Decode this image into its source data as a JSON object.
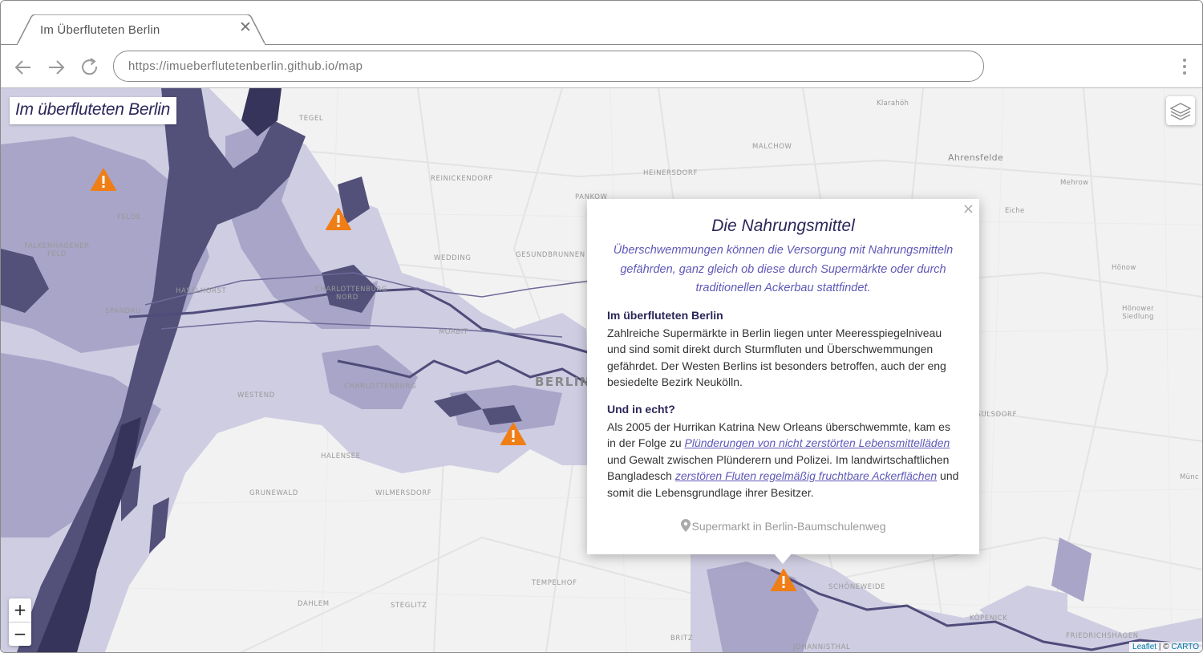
{
  "browser": {
    "tab_title": "Im Überfluteten Berlin",
    "url": "https://imueberflutetenberlin.github.io/map"
  },
  "map": {
    "title": "Im überfluteten Berlin",
    "zoom_in": "+",
    "zoom_out": "−",
    "attribution_leaflet": "Leaflet",
    "attribution_sep": " | © ",
    "attribution_carto": "CARTO",
    "flood_colors": {
      "light": "#cfcde2",
      "medium": "#a8a5c8",
      "dark": "#53507a",
      "darkest": "#36345a"
    },
    "marker_color": "#f07e16",
    "labels": {
      "klarahoh": "Klarahöh",
      "tegel": "TEGEL",
      "malchow": "MALCHOW",
      "ahrensfelde": "Ahrensfelde",
      "reinickendorf": "REINICKENDORF",
      "heinersdorf": "HEINERSDORF",
      "mehrow": "Mehrow",
      "pankow": "PANKOW",
      "eiche": "Eiche",
      "falkenhagener_feld": "FALKENHAGENER FELD",
      "wedding": "WEDDING",
      "gesundbrunnen": "GESUNDBRUNNEN",
      "honow": "Hönow",
      "haselhorst": "HASELHORST",
      "charlottenburg_nord": "CHARLOTTENBURG NORD",
      "spandau": "SPANDAU",
      "honower_siedlung": "Hönower Siedlung",
      "moabit": "MOABIT",
      "berlin": "BERLIN",
      "westend": "WESTEND",
      "charlottenburg": "CHARLOTTENBURG",
      "kaulsdorf": "KAULSDORF",
      "halensee": "HALENSEE",
      "munch": "Münc",
      "wilmersdorf": "WILMERSDORF",
      "grunewald": "GRUNEWALD",
      "tempelhof": "TEMPELHOF",
      "schoneweide": "SCHÖNEWEIDE",
      "dahlem": "DAHLEM",
      "steglitz": "STEGLITZ",
      "kopenick": "KÖPENICK",
      "britz": "BRITZ",
      "friedrichshagen": "FRIEDRICHSHAGEN",
      "johannisthal": "JOHANNISTHAL",
      "felde": "FELDE"
    }
  },
  "popup": {
    "close": "×",
    "heading": "Die Nahrungsmittel",
    "intro": "Überschwemmungen können die Versorgung mit Nahrungsmitteln gefährden, ganz gleich ob diese durch Supermärkte oder durch traditionellen Ackerbau stattfindet.",
    "section1_title": "Im überfluteten Berlin",
    "section1_text": "Zahlreiche Supermärkte in Berlin liegen unter Meeresspiegelniveau und sind somit direkt durch Sturmfluten und Überschwemmungen gefährdet. Der Westen Berlins ist besonders betroffen, auch der eng besiedelte Bezirk Neukölln.",
    "section2_title": "Und in echt?",
    "section2_text_a": "Als 2005 der Hurrikan Katrina New Orleans überschwemmte, kam es in der Folge zu ",
    "section2_link1": "Plünderungen von nicht zerstörten Lebensmittelläden",
    "section2_text_b": " und Gewalt zwischen Plünderern und Polizei. Im landwirtschaftlichen Bangladesch ",
    "section2_link2": "zerstören Fluten regelmäßig fruchtbare Ackerflächen",
    "section2_text_c": " und somit die Lebensgrundlage ihrer Besitzer.",
    "location": "Supermarkt in Berlin-Baumschulenweg"
  }
}
